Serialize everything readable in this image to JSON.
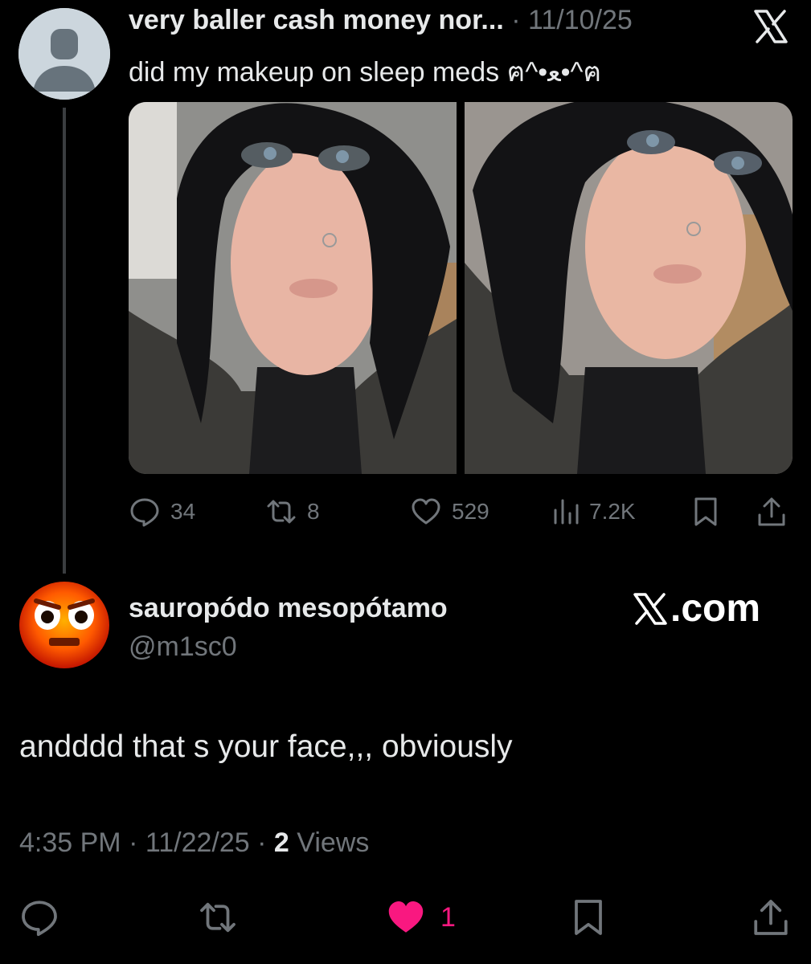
{
  "parent_tweet": {
    "author_name": "very baller cash money nor...",
    "separator": "·",
    "date": "11/10/25",
    "text": "did my makeup on sleep meds ฅ^•ﻌ•^ฅ",
    "stats": {
      "replies": "34",
      "reposts": "8",
      "likes": "529",
      "views": "7.2K"
    }
  },
  "reply_tweet": {
    "author_name": "sauropódo mesopótamo",
    "handle": "@m1sc0",
    "watermark": ".com",
    "text": "andddd that s your face,,, obviously",
    "time": "4:35 PM",
    "date": "11/22/25",
    "views_count": "2",
    "views_label": "Views",
    "likes": "1"
  },
  "icons": {
    "close": "x-logo-icon",
    "reply": "speech-bubble-icon",
    "repost": "repost-arrows-icon",
    "like": "heart-icon",
    "views": "bar-chart-icon",
    "bookmark": "bookmark-icon",
    "share": "share-upload-icon"
  },
  "colors": {
    "background": "#000000",
    "text": "#e7e9ea",
    "muted": "#71767b",
    "like_active": "#f91880"
  }
}
